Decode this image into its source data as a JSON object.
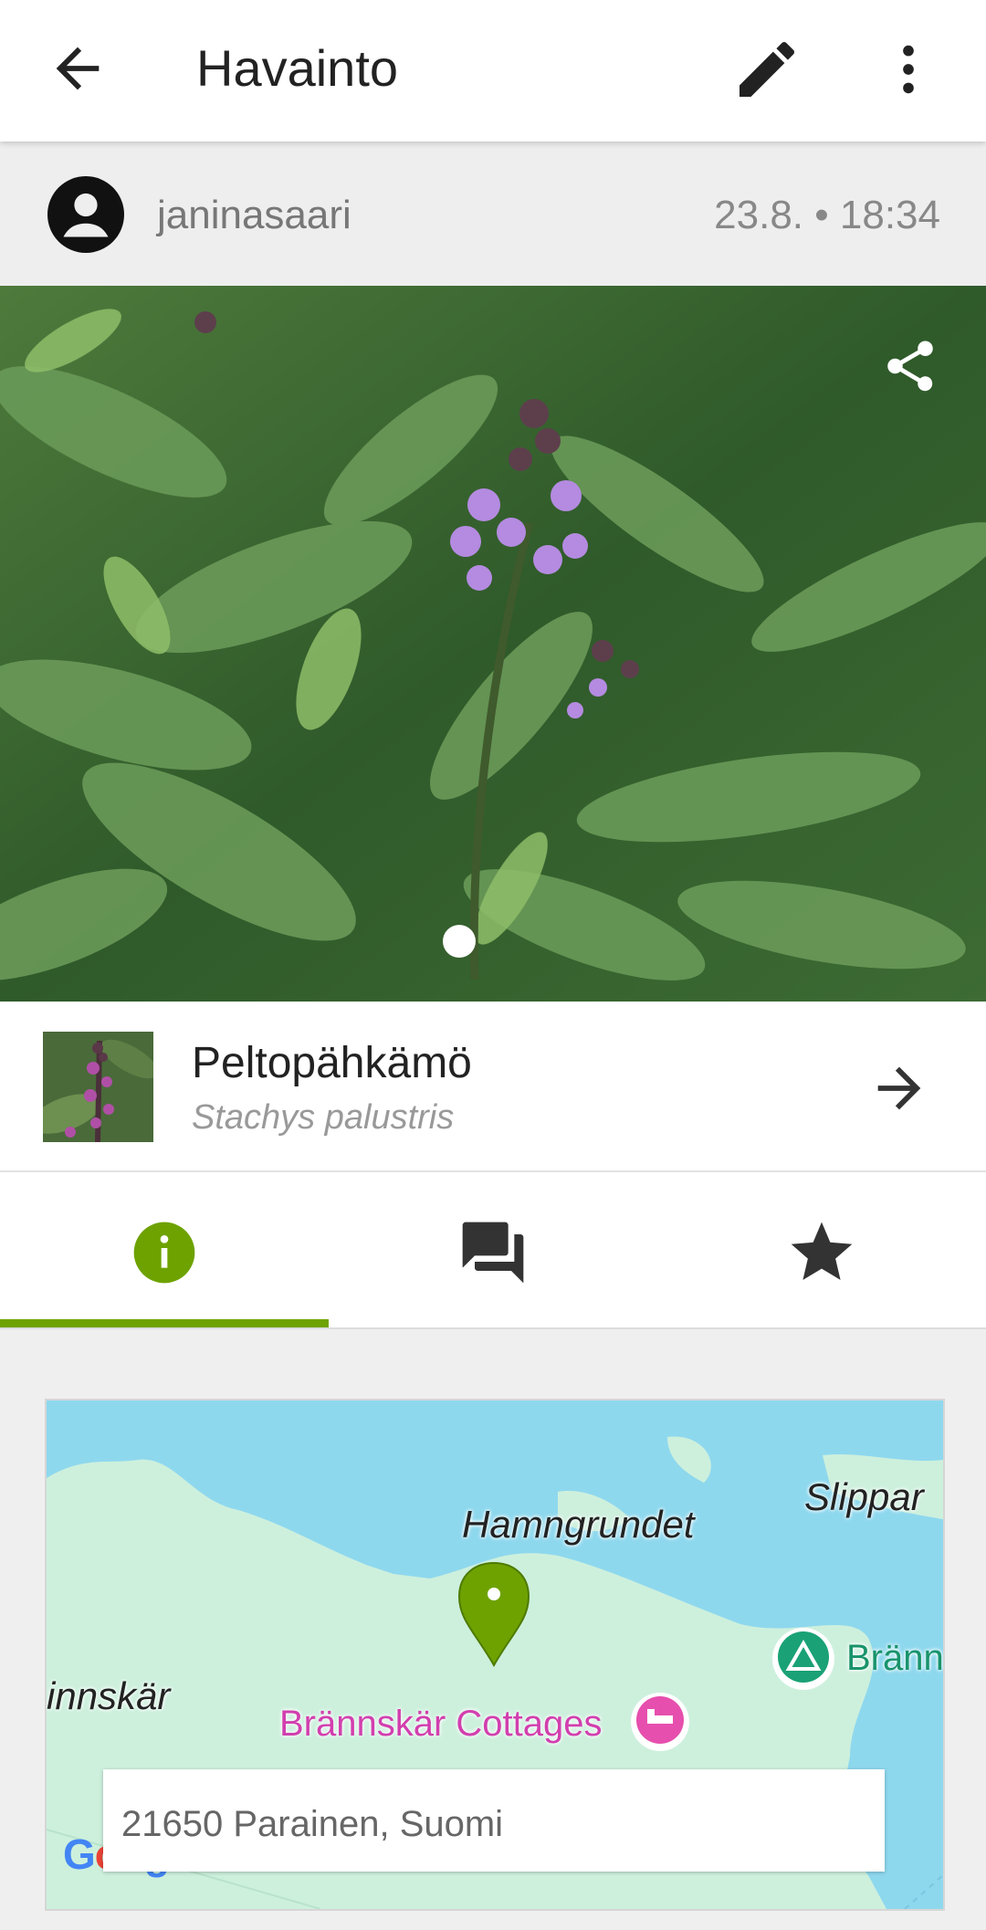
{
  "appbar": {
    "title": "Havainto",
    "icons": {
      "back": "arrow-back-icon",
      "edit": "pencil-icon",
      "more": "more-vert-icon"
    }
  },
  "observation": {
    "username": "janinasaari",
    "datetime": "23.8. • 18:34",
    "photo_count_dots": 1
  },
  "species": {
    "common_name": "Peltopähkämö",
    "scientific_name": "Stachys palustris"
  },
  "tabs": [
    {
      "name": "info",
      "icon": "info-icon",
      "active": true
    },
    {
      "name": "comments",
      "icon": "chat-icon",
      "active": false
    },
    {
      "name": "favorite",
      "icon": "star-icon",
      "active": false
    }
  ],
  "map": {
    "labels": {
      "place1": "Hamngrundet",
      "place2": "Slippar",
      "place3": "innskär",
      "poi_cottages": "Brännskär Cottages",
      "poi_camp": "Bränn"
    },
    "address": "21650 Parainen, Suomi",
    "attribution": "Google"
  },
  "colors": {
    "accent": "#6ea200",
    "map_water": "#8ed8ee",
    "map_land": "#cdf0dd",
    "poi_pink": "#d23fae",
    "poi_green": "#19936b"
  }
}
